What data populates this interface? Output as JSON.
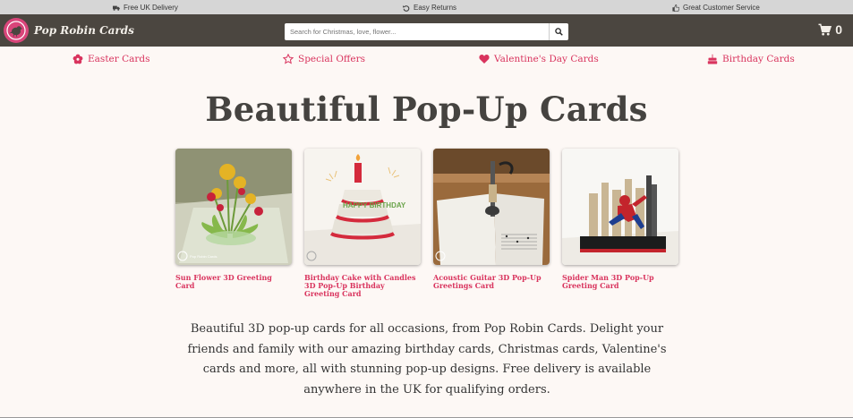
{
  "topbar": {
    "delivery": "Free UK Delivery",
    "returns": "Easy Returns",
    "service": "Great Customer Service"
  },
  "header": {
    "logo_text": "Pop Robin Cards",
    "search_placeholder": "Search for Christmas, love, flower...",
    "cart_count": "0"
  },
  "nav": {
    "items": [
      {
        "label": "Easter Cards",
        "icon": "flower-icon"
      },
      {
        "label": "Special Offers",
        "icon": "star-icon"
      },
      {
        "label": "Valentine's Day Cards",
        "icon": "heart-icon"
      },
      {
        "label": "Birthday Cards",
        "icon": "cake-icon"
      }
    ]
  },
  "main": {
    "title": "Beautiful Pop-Up Cards",
    "cards": [
      {
        "title": "Sun Flower 3D Greeting Card"
      },
      {
        "title": "Birthday Cake with Candles 3D Pop-Up Birthday Greeting Card"
      },
      {
        "title": "Acoustic Guitar 3D Pop-Up Greetings Card"
      },
      {
        "title": "Spider Man 3D Pop-Up Greeting Card"
      }
    ],
    "watermark": "Pop Robin Cards",
    "cake_text": "HAPPY BIRTHDAY",
    "description": "Beautiful 3D pop-up cards for all occasions, from Pop Robin Cards. Delight your friends and family with our amazing birthday cards, Christmas cards, Valentine's cards and more, all with stunning pop-up designs. Free delivery is available anywhere in the UK for qualifying orders."
  },
  "colors": {
    "brand_pink": "#d9345e",
    "header_bg": "#4b4640",
    "page_bg": "#fdf8f5"
  }
}
